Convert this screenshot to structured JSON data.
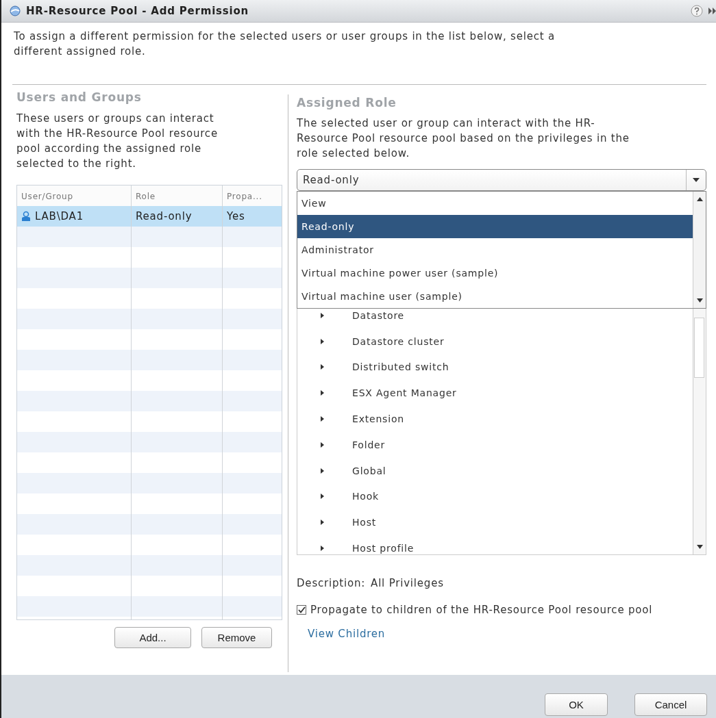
{
  "window": {
    "title": "HR-Resource Pool - Add Permission"
  },
  "intro": "To assign a different permission for the selected users or user groups in the list below, select a different assigned role.",
  "users_and_groups": {
    "heading": "Users and Groups",
    "description": "These users or groups can interact with the HR-Resource Pool resource pool according the assigned role selected to the right.",
    "table": {
      "columns": [
        "User/Group",
        "Role",
        "Propa..."
      ],
      "rows": [
        {
          "cells": [
            "LAB\\DA1",
            "Read-only",
            "Yes"
          ],
          "selected": true
        }
      ]
    },
    "buttons": [
      "Add...",
      "Remove"
    ]
  },
  "assigned_role": {
    "heading": "Assigned Role",
    "description": "The selected user or group can interact with the HR-Resource Pool resource pool based on the privileges in the role selected below.",
    "role_dropdown": {
      "value": "Read-only",
      "expanded": true,
      "options": [
        {
          "label": "View",
          "selected": false
        },
        {
          "label": "Read-only",
          "selected": true
        },
        {
          "label": "Administrator",
          "selected": false
        },
        {
          "label": "Virtual machine power user (sample)",
          "selected": false
        },
        {
          "label": "Virtual machine user (sample)",
          "selected": false
        }
      ]
    },
    "privileges": [
      {
        "label": "Datastore",
        "expanded": false
      },
      {
        "label": "Datastore cluster",
        "expanded": false
      },
      {
        "label": "Distributed switch",
        "expanded": false
      },
      {
        "label": "ESX Agent Manager",
        "expanded": false
      },
      {
        "label": "Extension",
        "expanded": false
      },
      {
        "label": "Folder",
        "expanded": false
      },
      {
        "label": "Global",
        "expanded": false
      },
      {
        "label": "Hook",
        "expanded": false
      },
      {
        "label": "Host",
        "expanded": false
      },
      {
        "label": "Host profile",
        "expanded": false
      }
    ],
    "description_label": "Description:",
    "description_value": "All Privileges",
    "propagate": {
      "label": "Propagate to children of the HR-Resource Pool resource pool",
      "checked": true
    },
    "view_children_link": "View Children"
  },
  "buttons": [
    "OK",
    "Cancel"
  ]
}
